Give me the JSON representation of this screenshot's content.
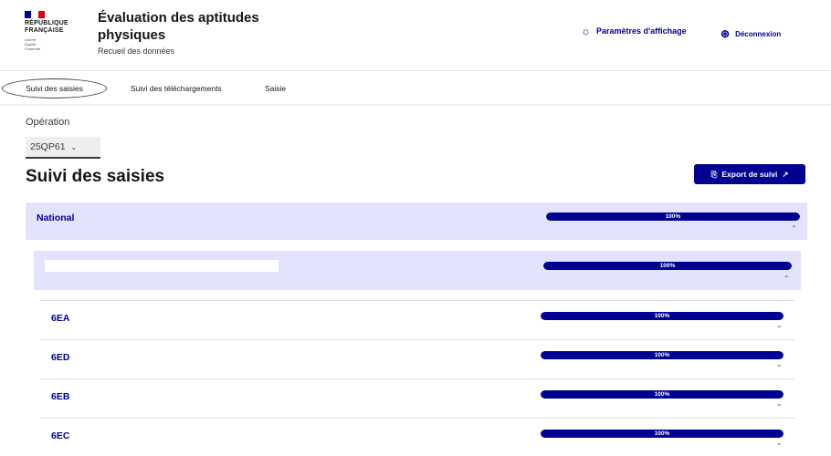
{
  "header": {
    "logo_lines": [
      "RÉPUBLIQUE",
      "FRANÇAISE"
    ],
    "motto": [
      "Liberté",
      "Égalité",
      "Fraternité"
    ],
    "title": "Évaluation des aptitudes physiques",
    "subtitle": "Recueil des données",
    "display_settings": "Paramètres d'affichage",
    "logout": "Déconnexion",
    "flag_colors": [
      "#000091",
      "#ffffff",
      "#e1000f"
    ]
  },
  "tabs": [
    {
      "label": "Suivi des saisies",
      "active": true
    },
    {
      "label": "Suivi des téléchargements",
      "active": false
    },
    {
      "label": "Saisie",
      "active": false
    }
  ],
  "operation": {
    "label": "Opération",
    "selected": "25QP61"
  },
  "page_title": "Suivi des saisies",
  "export_button": "Export de suivi",
  "rows": {
    "national": {
      "label": "National",
      "progress": 100,
      "progress_text": "100%",
      "expanded": true
    },
    "school": {
      "label": "",
      "progress": 100,
      "progress_text": "100%",
      "expanded": true
    },
    "classes": [
      {
        "label": "6EA",
        "progress": 100,
        "progress_text": "100%",
        "expanded": false
      },
      {
        "label": "6ED",
        "progress": 100,
        "progress_text": "100%",
        "expanded": false
      },
      {
        "label": "6EB",
        "progress": 100,
        "progress_text": "100%",
        "expanded": false
      },
      {
        "label": "6EC",
        "progress": 100,
        "progress_text": "100%",
        "expanded": false
      }
    ]
  },
  "icons": {
    "display": "sun-icon",
    "logout": "user-circle-icon",
    "export": "download-file-icon",
    "external": "external-link-icon",
    "expanded": "chevron-up-icon",
    "collapsed": "chevron-down-icon"
  },
  "colors": {
    "accent": "#000091",
    "row_bg": "#e3e3fd"
  }
}
